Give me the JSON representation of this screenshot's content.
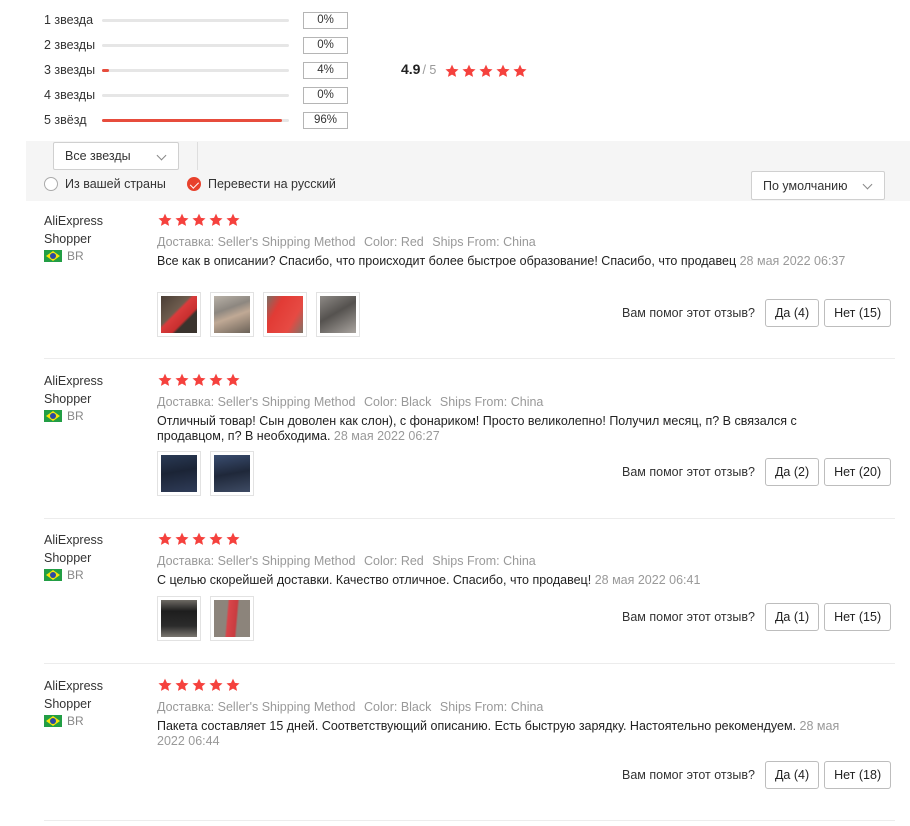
{
  "distribution": [
    {
      "label": "1 звезда",
      "percent_text": "0%",
      "fill": 0
    },
    {
      "label": "2 звезды",
      "percent_text": "0%",
      "fill": 0
    },
    {
      "label": "3 звезды",
      "percent_text": "4%",
      "fill": 0.04
    },
    {
      "label": "4 звезды",
      "percent_text": "0%",
      "fill": 0
    },
    {
      "label": "5 звёзд",
      "percent_text": "96%",
      "fill": 0.96
    }
  ],
  "average": {
    "score": "4.9",
    "max": "/ 5",
    "stars": 5
  },
  "filters": {
    "stars_select": "Все звезды",
    "from_country": "Из вашей страны",
    "from_country_checked": false,
    "translate": "Перевести на русский",
    "translate_checked": true,
    "sort": "По умолчанию"
  },
  "colors": {
    "accent": "#e8412c",
    "star": "#f5413d",
    "meta": "#999999"
  },
  "reviews": [
    {
      "name": "AliExpress Shopper",
      "country": "BR",
      "stars": 5,
      "shipping": "Доставка: Seller's Shipping Method",
      "color": "Color: Red",
      "ships_from": "Ships From: China",
      "text": "Все как в описании? Спасибо, что происходит более быстрое образование! Спасибо, что продавец",
      "date": "28 мая 2022 06:37",
      "photos": [
        "photo-red-case-1",
        "photo-hand-phone",
        "photo-red-case-2",
        "photo-phone-grey"
      ],
      "helpful_label": "Вам помог этот отзыв?",
      "yes": "Да (4)",
      "no": "Нет (15)"
    },
    {
      "name": "AliExpress Shopper",
      "country": "BR",
      "stars": 5,
      "shipping": "Доставка: Seller's Shipping Method",
      "color": "Color: Black",
      "ships_from": "Ships From: China",
      "text": "Отличный товар! Сын доволен как слон), с фонариком! Просто великолепно! Получил месяц, п? В связался с продавцом, п? В необходима.",
      "date": "28 мая 2022 06:27",
      "photos": [
        "photo-black-phone-1",
        "photo-black-phone-2"
      ],
      "helpful_label": "Вам помог этот отзыв?",
      "yes": "Да (2)",
      "no": "Нет (20)"
    },
    {
      "name": "AliExpress Shopper",
      "country": "BR",
      "stars": 5,
      "shipping": "Доставка: Seller's Shipping Method",
      "color": "Color: Red",
      "ships_from": "Ships From: China",
      "text": "С целью скорейшей доставки. Качество отличное. Спасибо, что продавец!",
      "date": "28 мая 2022 06:41",
      "photos": [
        "photo-dark-case",
        "photo-red-case-3"
      ],
      "helpful_label": "Вам помог этот отзыв?",
      "yes": "Да (1)",
      "no": "Нет (15)"
    },
    {
      "name": "AliExpress Shopper",
      "country": "BR",
      "stars": 5,
      "shipping": "Доставка: Seller's Shipping Method",
      "color": "Color: Black",
      "ships_from": "Ships From: China",
      "text": "Пакета составляет 15 дней. Соответствующий описанию. Есть быструю зарядку. Настоятельно рекомендуем.",
      "date": "28 мая 2022 06:44",
      "photos": [],
      "helpful_label": "Вам помог этот отзыв?",
      "yes": "Да (4)",
      "no": "Нет (18)"
    }
  ]
}
